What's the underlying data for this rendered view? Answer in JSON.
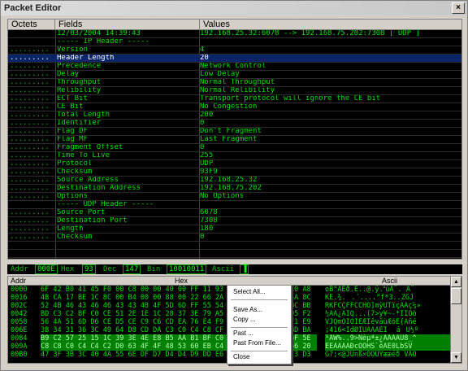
{
  "window": {
    "title": "Packet Editor",
    "close_label": "×"
  },
  "grid": {
    "headers": {
      "octets": "Octets",
      "fields": "Fields",
      "values": "Values"
    },
    "rows": [
      {
        "o": "",
        "f": "12/03/2004 14:39:43",
        "v": "192.168.25.32:6078 --> 192.168.75.202:7308 [ UDP ]"
      },
      {
        "o": "",
        "f": "----- IP Header -----",
        "v": ""
      },
      {
        "o": ".........",
        "f": "Version",
        "v": "4"
      },
      {
        "o": ".........",
        "f": "Header Length",
        "v": "20",
        "sel": true
      },
      {
        "o": ".........",
        "f": "Precedence",
        "v": "Network Control"
      },
      {
        "o": ".........",
        "f": "Delay",
        "v": "Low Delay"
      },
      {
        "o": ".........",
        "f": "Throughput",
        "v": "Normal Throughput"
      },
      {
        "o": ".........",
        "f": "Relibility",
        "v": "Normal Relibility"
      },
      {
        "o": ".........",
        "f": "ECT Bit",
        "v": "Transport protocol will ignore the CE bit"
      },
      {
        "o": ".........",
        "f": "CE Bit",
        "v": "No Congestion"
      },
      {
        "o": ".........",
        "f": "Total Length",
        "v": "200"
      },
      {
        "o": ".........",
        "f": "Identifier",
        "v": "0"
      },
      {
        "o": ".........",
        "f": "Flag DF",
        "v": "Don't Fragment"
      },
      {
        "o": ".........",
        "f": "Flag MF",
        "v": "Last Fragment"
      },
      {
        "o": ".........",
        "f": "Fragment Offset",
        "v": "0"
      },
      {
        "o": ".........",
        "f": "Time To Live",
        "v": "255"
      },
      {
        "o": ".........",
        "f": "Protocol",
        "v": "UDP"
      },
      {
        "o": ".........",
        "f": "Checksum",
        "v": "93F9"
      },
      {
        "o": ".........",
        "f": "Source Address",
        "v": "192.168.25.32"
      },
      {
        "o": ".........",
        "f": "Destination Address",
        "v": "192.168.75.202"
      },
      {
        "o": ".........",
        "f": "Options",
        "v": "No Options"
      },
      {
        "o": "",
        "f": "----- UDP Header -----",
        "v": ""
      },
      {
        "o": ".........",
        "f": "Source Port",
        "v": "6078"
      },
      {
        "o": ".........",
        "f": "Destination Port",
        "v": "7308"
      },
      {
        "o": ".........",
        "f": "Length",
        "v": "180"
      },
      {
        "o": ".........",
        "f": "Checksum",
        "v": "0"
      },
      {
        "o": "",
        "f": "",
        "v": ""
      },
      {
        "o": "",
        "f": "",
        "v": ""
      },
      {
        "o": "",
        "f": "",
        "v": ""
      },
      {
        "o": "",
        "f": "",
        "v": ""
      },
      {
        "o": "",
        "f": "",
        "v": ""
      }
    ]
  },
  "status": {
    "addr_label": "Addr",
    "addr_value": "000E",
    "hex_label": "Hex",
    "hex_value": "93",
    "dec_label": "Dec",
    "dec_value": "147",
    "bin_label": "Bin",
    "bin_value": "10010011",
    "ascii_label": "Ascii",
    "ascii_value": "▐"
  },
  "hex": {
    "headers": {
      "addr": "Addr",
      "hex": "Hex",
      "ascii": "Ascii"
    },
    "rows": [
      {
        "a": "0000",
        "h": "6F 42 B0 41 45 F0 00 C8 00 00 40 00 FF 11 93 F9 C0 A8 19 20 C0 A8",
        "s": "oB°AEð.È..@.ÿ.ùÀ¨. À¨",
        "hl": false
      },
      {
        "a": "0016",
        "h": "4B CA 17 BE 1C 8C 00 B4 00 00 88 00 22 66 2A 33 04 00 5A 47 4A 8C",
        "s": "KÊ.¾..´....\"f*3..ZGJ",
        "hl": false
      },
      {
        "a": "002C",
        "s": "RKFCÇFFCCHO]mÿUTïçÄÄç¼»",
        "h": "52 4B 46 43 46 46 43 43 48 4F 5D 6D FF 55 54 EF E7 C4 C4 E7 BC BB",
        "hl": false
      },
      {
        "a": "0042",
        "h": "BD C3 C2 BF C0 CE 51 2E 1E 1C 28 37 3E 79 A5 7E 2D 2A CE CF D5 F2",
        "s": "½ÃÂ¿ÀÎQ...(7>y¥~-*ÎÏÕò",
        "hl": false
      },
      {
        "a": "0058",
        "h": "56 4A 51 6D D6 CE D5 CE C9 C6 CD EA 76 E4 F9 C6 F3 CB 7B C3 F1 E9",
        "s": "VJQmÖÎÕÎÉÆÍêväùÆóË{Ãñé",
        "hl": false
      },
      {
        "a": "006E",
        "h": "3B 34 31 36 3C 49 64 D8 CD DA C3 C0 C4 C8 CF 9D 97 E1 9C DB BD BA",
        "s": ";416<IdØÍÚÃÀÄÈÏáÛ½º",
        "hl": false
      },
      {
        "a": "0084",
        "h": "B9 C2 57 25 15 1C 39 3E 4E E8 B5 AA B1 BF C0 C1 C2 C3 DB 38 5F 5E",
        "s": "¹ÂW%..9>Nèµª±¿ÀÁÂÃÛ8_^",
        "hl": true
      },
      {
        "a": "009A",
        "h": "C8 C8 C0 C4 C4 C2 D0 63 4F 4F 48 53 60 EB C4 CB 30 4C 62 53 56 20",
        "s": "ÈÈÀÄÄÂÐcOOHS`ëÄË0LbSV ",
        "hl": true
      },
      {
        "a": "00B0",
        "h": "47 3F 3B 3C 40 4A 55 6E DF D7 D4 D4 D9 DD E6 E6 E9 F0 91 56 C3 D3",
        "s": "G?;<@JUnß×ÔÔÙÝææéðVÃÓ",
        "hl": false
      }
    ]
  },
  "context_menu": {
    "items": [
      {
        "name": "select-all",
        "label": "Select All..."
      },
      {
        "name": "save-as",
        "label": "Save As..."
      },
      {
        "name": "copy",
        "label": "Copy ..."
      },
      {
        "name": "past",
        "label": "Past ..."
      },
      {
        "name": "past-from-file",
        "label": "Past From File..."
      },
      {
        "name": "close",
        "label": "Close"
      }
    ]
  }
}
